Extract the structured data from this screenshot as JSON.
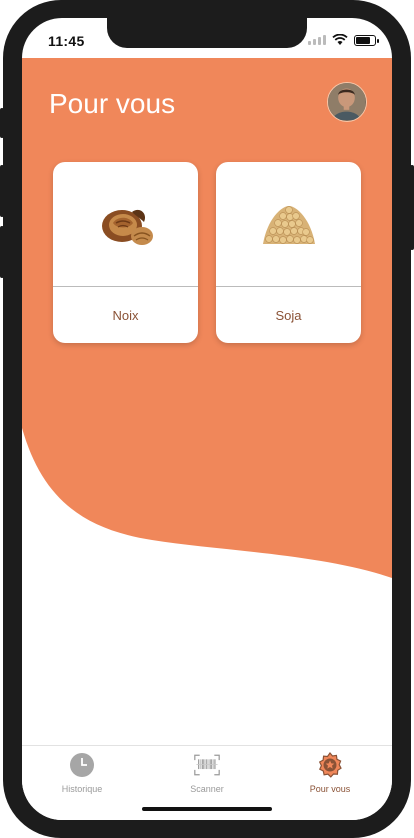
{
  "status_bar": {
    "time": "11:45"
  },
  "header": {
    "title": "Pour vous"
  },
  "colors": {
    "accent": "#f0875a",
    "label": "#8a5236",
    "inactive": "#9a9a9a"
  },
  "cards": [
    {
      "label": "Noix",
      "icon": "walnut-image"
    },
    {
      "label": "Soja",
      "icon": "soybeans-image"
    }
  ],
  "tabbar": {
    "items": [
      {
        "label": "Historique",
        "icon": "clock-icon",
        "active": false
      },
      {
        "label": "Scanner",
        "icon": "barcode-scanner-icon",
        "active": false
      },
      {
        "label": "Pour vous",
        "icon": "star-badge-icon",
        "active": true
      }
    ]
  }
}
